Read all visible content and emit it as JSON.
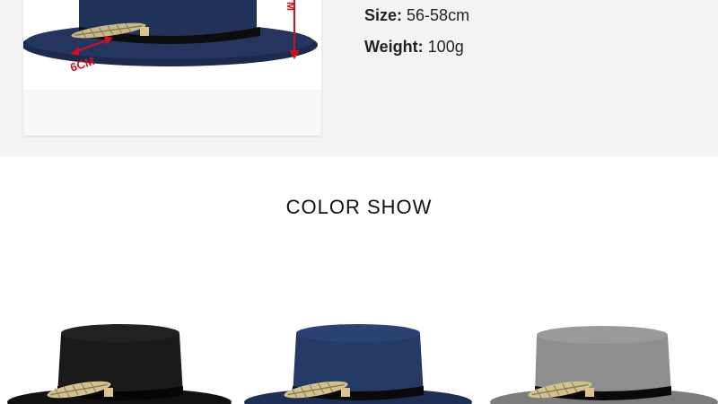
{
  "specs": {
    "size_label": "Size:",
    "size_value": "56-58cm",
    "weight_label": "Weight:",
    "weight_value": "100g"
  },
  "photo": {
    "brim_dimension": "6CM",
    "height_dimension_fragment": "M",
    "hat_color": "#1f2d52",
    "dimension_color": "#d0101a"
  },
  "color_show": {
    "title": "COLOR SHOW",
    "hats": [
      {
        "color_name": "black",
        "crown": "#1a1a1a",
        "brim": "#111111"
      },
      {
        "color_name": "navy",
        "crown": "#263a66",
        "brim": "#1e2f56"
      },
      {
        "color_name": "gray",
        "crown": "#8e8e8e",
        "brim": "#7c7c7c"
      }
    ]
  }
}
